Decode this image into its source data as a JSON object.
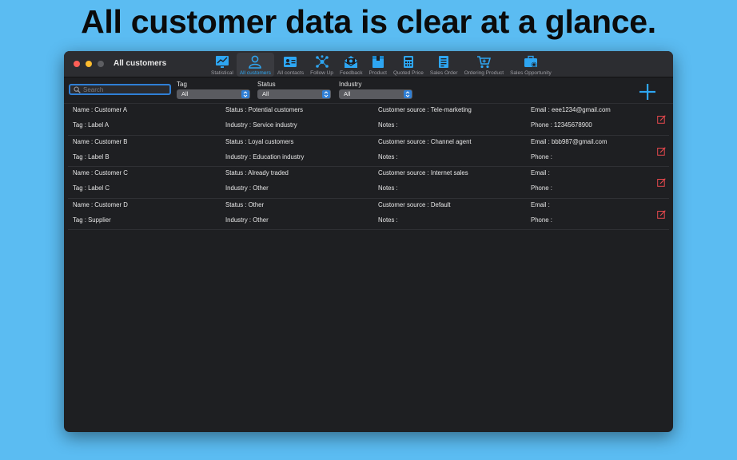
{
  "headline": "All customer data is clear at a glance.",
  "window": {
    "title": "All customers"
  },
  "toolbar": {
    "items": [
      {
        "label": "Statistical",
        "icon": "chart-icon",
        "active": false
      },
      {
        "label": "All customers",
        "icon": "customers-icon",
        "active": true
      },
      {
        "label": "All contacts",
        "icon": "contacts-icon",
        "active": false
      },
      {
        "label": "Follow Up",
        "icon": "follow-up-icon",
        "active": false
      },
      {
        "label": "Feedback",
        "icon": "feedback-icon",
        "active": false
      },
      {
        "label": "Product",
        "icon": "product-icon",
        "active": false
      },
      {
        "label": "Quoted Price",
        "icon": "calculator-icon",
        "active": false
      },
      {
        "label": "Sales Order",
        "icon": "order-icon",
        "active": false
      },
      {
        "label": "Ordering Product",
        "icon": "cart-icon",
        "active": false
      },
      {
        "label": "Sales Opportunity",
        "icon": "briefcase-icon",
        "active": false
      }
    ]
  },
  "filters": {
    "search_placeholder": "Search",
    "tag": {
      "label": "Tag",
      "value": "All"
    },
    "status": {
      "label": "Status",
      "value": "All"
    },
    "industry": {
      "label": "Industry",
      "value": "All"
    }
  },
  "customers": [
    {
      "name": "Name : Customer A",
      "tag": "Tag : Label A",
      "status": "Status : Potential customers",
      "industry": "Industry : Service industry",
      "source": "Customer source : Tele-marketing",
      "notes": "Notes :",
      "email": "Email : eee1234@gmail.com",
      "phone": "Phone : 12345678900"
    },
    {
      "name": "Name : Customer B",
      "tag": "Tag : Label B",
      "status": "Status : Loyal customers",
      "industry": "Industry : Education industry",
      "source": "Customer source : Channel agent",
      "notes": "Notes :",
      "email": "Email : bbb987@gmail.com",
      "phone": "Phone :"
    },
    {
      "name": "Name : Customer C",
      "tag": "Tag : Label C",
      "status": "Status : Already traded",
      "industry": "Industry : Other",
      "source": "Customer source : Internet sales",
      "notes": "Notes :",
      "email": "Email :",
      "phone": "Phone :"
    },
    {
      "name": "Name : Customer D",
      "tag": "Tag : Supplier",
      "status": "Status : Other",
      "industry": "Industry : Other",
      "source": "Customer source : Default",
      "notes": "Notes :",
      "email": "Email :",
      "phone": "Phone :"
    }
  ],
  "colors": {
    "background": "#5bbcf2",
    "accent": "#2ea6f2",
    "edit": "#e5484d",
    "window": "#1e1f22"
  }
}
